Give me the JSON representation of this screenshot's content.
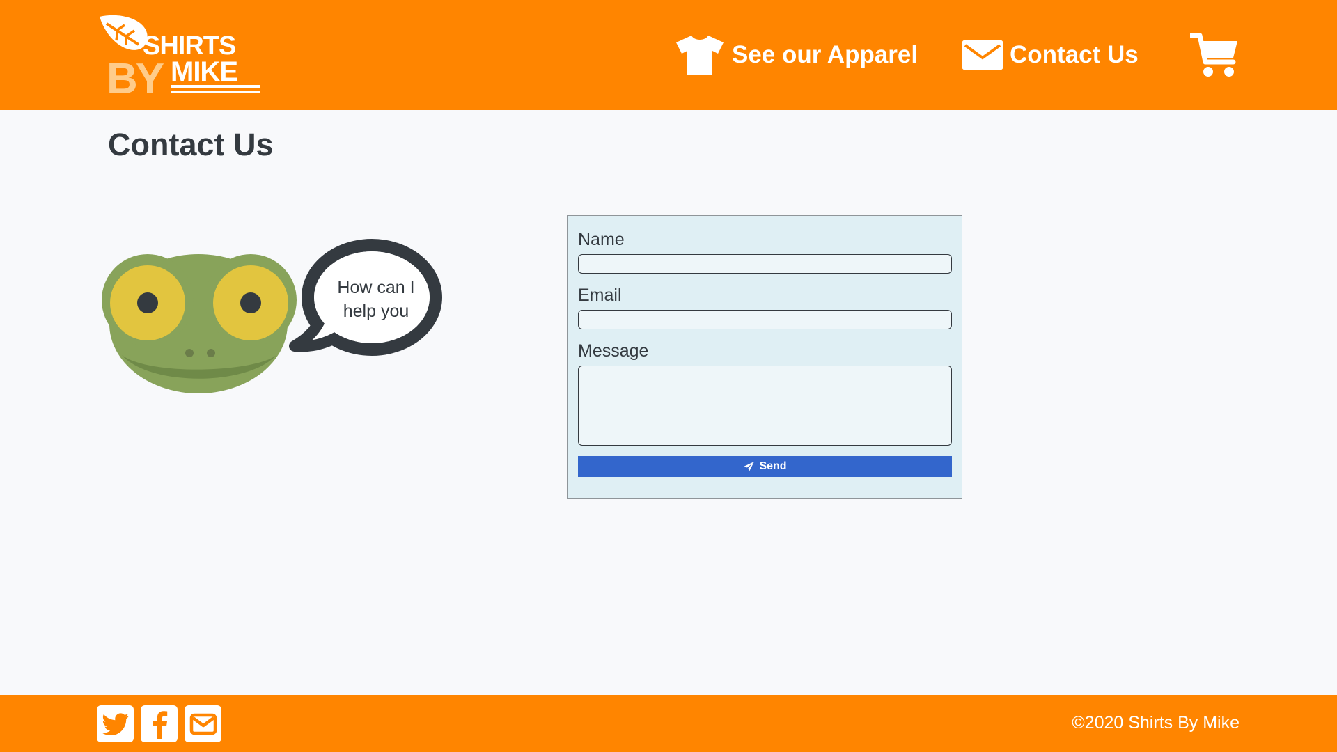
{
  "brand": {
    "logo_line1": "SHIRTS",
    "logo_line2_left": "BY",
    "logo_line2_right": "MIKE",
    "logo_icon": "leaf-icon"
  },
  "colors": {
    "header_bg": "#ff8500",
    "footer_bg": "#ff8500",
    "page_bg": "#f8f9fb",
    "form_bg": "#dfeff4",
    "send_button_bg": "#3366cc",
    "text_dark": "#343a40"
  },
  "nav": {
    "apparel_label": "See our Apparel",
    "apparel_icon": "tshirt-icon",
    "contact_label": "Contact Us",
    "contact_icon": "envelope-icon",
    "cart_icon": "shopping-cart-icon"
  },
  "main": {
    "title": "Contact Us",
    "mascot_speech": [
      "How can I",
      "help you"
    ]
  },
  "form": {
    "name_label": "Name",
    "name_value": "",
    "email_label": "Email",
    "email_value": "",
    "message_label": "Message",
    "message_value": "",
    "send_label": "Send",
    "send_icon": "paper-plane-icon"
  },
  "footer": {
    "social_icons": [
      "twitter-icon",
      "facebook-icon",
      "mail-icon"
    ],
    "copyright": "©2020 Shirts By Mike"
  }
}
